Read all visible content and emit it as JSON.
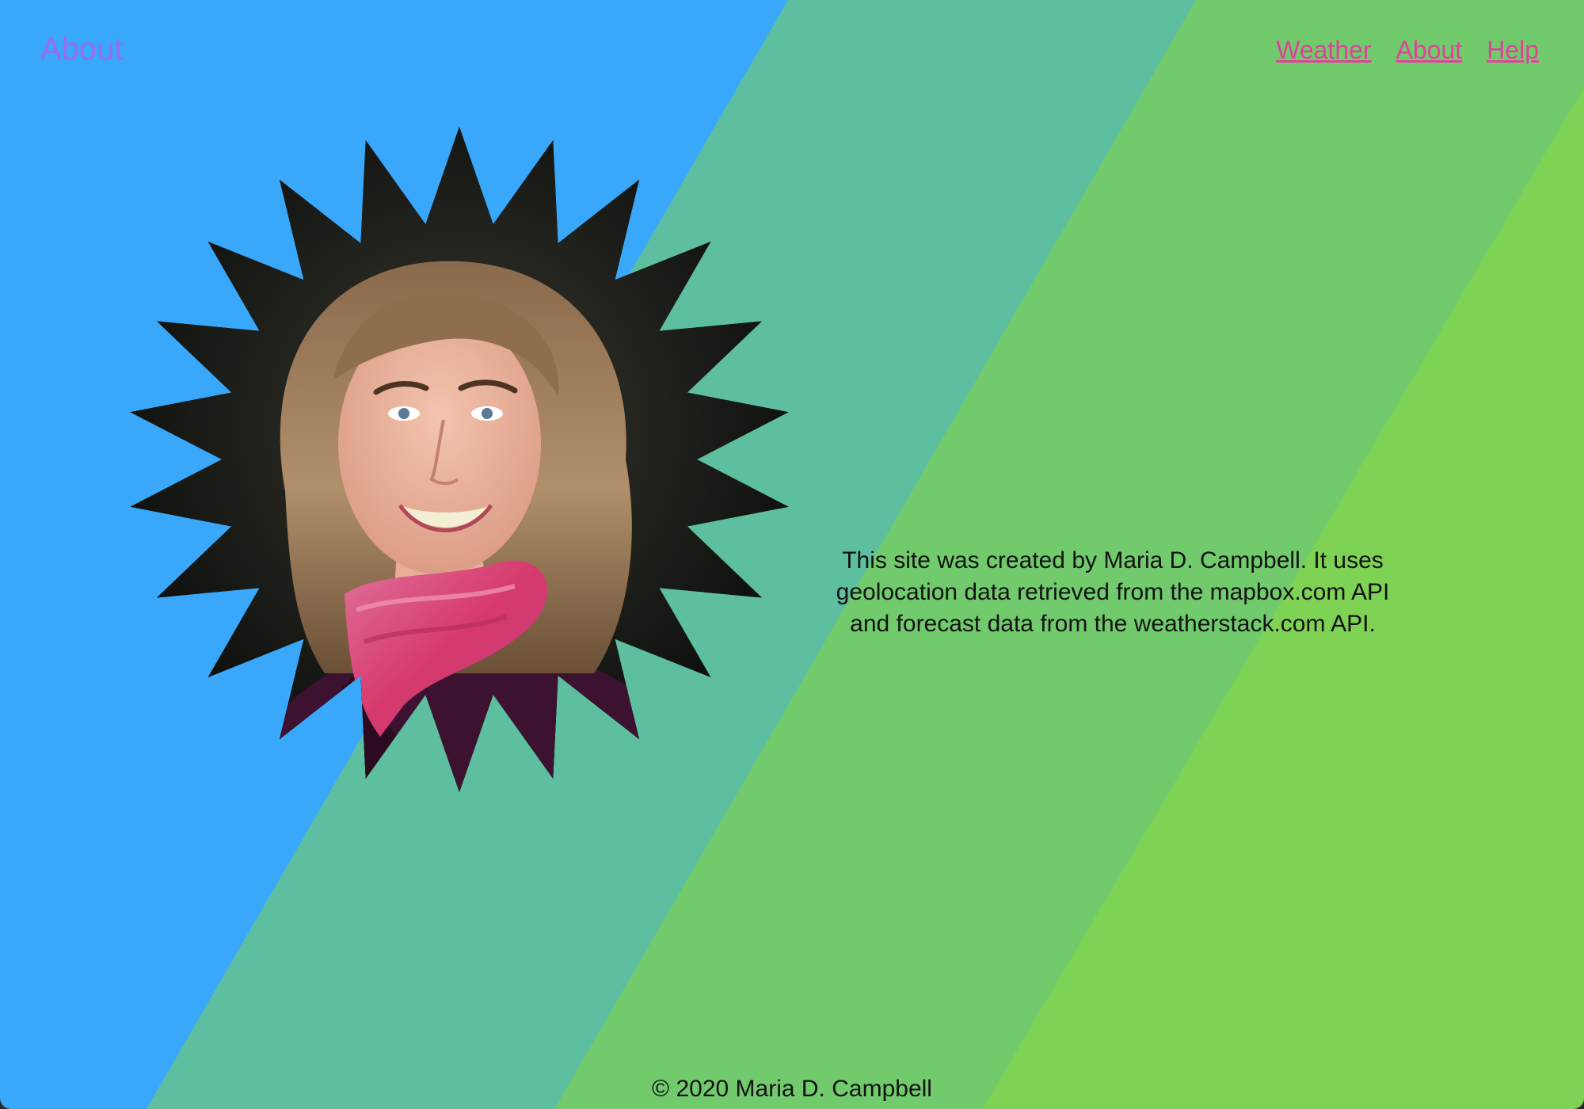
{
  "header": {
    "page_title": "About"
  },
  "nav": {
    "items": [
      {
        "label": "Weather"
      },
      {
        "label": "About"
      },
      {
        "label": "Help"
      }
    ]
  },
  "main": {
    "description": "This site was created by Maria D. Campbell. It uses geolocation data retrieved from the mapbox.com API and forecast data from the weatherstack.com API."
  },
  "footer": {
    "copyright": "© 2020 Maria D. Campbell"
  },
  "colors": {
    "band_blue": "#39a8fb",
    "band_teal": "#5dbf9f",
    "band_green": "#71cb6c",
    "band_lime": "#7ed354",
    "title_purple": "#9a6cf0",
    "nav_pink": "#e2409b",
    "text_dark": "#111111",
    "star_frame": "#0d0d0d"
  }
}
